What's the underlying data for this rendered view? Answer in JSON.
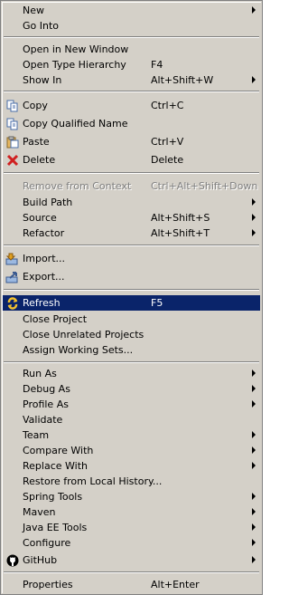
{
  "menu": {
    "new": {
      "label": "New"
    },
    "go_into": {
      "label": "Go Into"
    },
    "open_new_window": {
      "label": "Open in New Window"
    },
    "open_type_hierarchy": {
      "label": "Open Type Hierarchy",
      "shortcut": "F4"
    },
    "show_in": {
      "label": "Show In",
      "shortcut": "Alt+Shift+W"
    },
    "copy": {
      "label": "Copy",
      "shortcut": "Ctrl+C",
      "icon": "copy-icon"
    },
    "copy_qualified": {
      "label": "Copy Qualified Name",
      "icon": "copy-qualified-icon"
    },
    "paste": {
      "label": "Paste",
      "shortcut": "Ctrl+V",
      "icon": "paste-icon"
    },
    "delete": {
      "label": "Delete",
      "shortcut": "Delete",
      "icon": "delete-icon"
    },
    "remove_context": {
      "label": "Remove from Context",
      "shortcut": "Ctrl+Alt+Shift+Down"
    },
    "build_path": {
      "label": "Build Path"
    },
    "source": {
      "label": "Source",
      "shortcut": "Alt+Shift+S"
    },
    "refactor": {
      "label": "Refactor",
      "shortcut": "Alt+Shift+T"
    },
    "import": {
      "label": "Import...",
      "icon": "import-icon"
    },
    "export": {
      "label": "Export...",
      "icon": "export-icon"
    },
    "refresh": {
      "label": "Refresh",
      "shortcut": "F5",
      "icon": "refresh-icon"
    },
    "close_project": {
      "label": "Close Project"
    },
    "close_unrelated": {
      "label": "Close Unrelated Projects"
    },
    "assign_sets": {
      "label": "Assign Working Sets..."
    },
    "run_as": {
      "label": "Run As"
    },
    "debug_as": {
      "label": "Debug As"
    },
    "profile_as": {
      "label": "Profile As"
    },
    "validate": {
      "label": "Validate"
    },
    "team": {
      "label": "Team"
    },
    "compare_with": {
      "label": "Compare With"
    },
    "replace_with": {
      "label": "Replace With"
    },
    "restore_history": {
      "label": "Restore from Local History..."
    },
    "spring_tools": {
      "label": "Spring Tools"
    },
    "maven": {
      "label": "Maven"
    },
    "java_ee_tools": {
      "label": "Java EE Tools"
    },
    "configure": {
      "label": "Configure"
    },
    "github": {
      "label": "GitHub",
      "icon": "github-icon"
    },
    "properties": {
      "label": "Properties",
      "shortcut": "Alt+Enter"
    }
  },
  "colors": {
    "menu_bg": "#d4d0c8",
    "selection_bg": "#0a246a",
    "disabled_text": "#808080"
  }
}
